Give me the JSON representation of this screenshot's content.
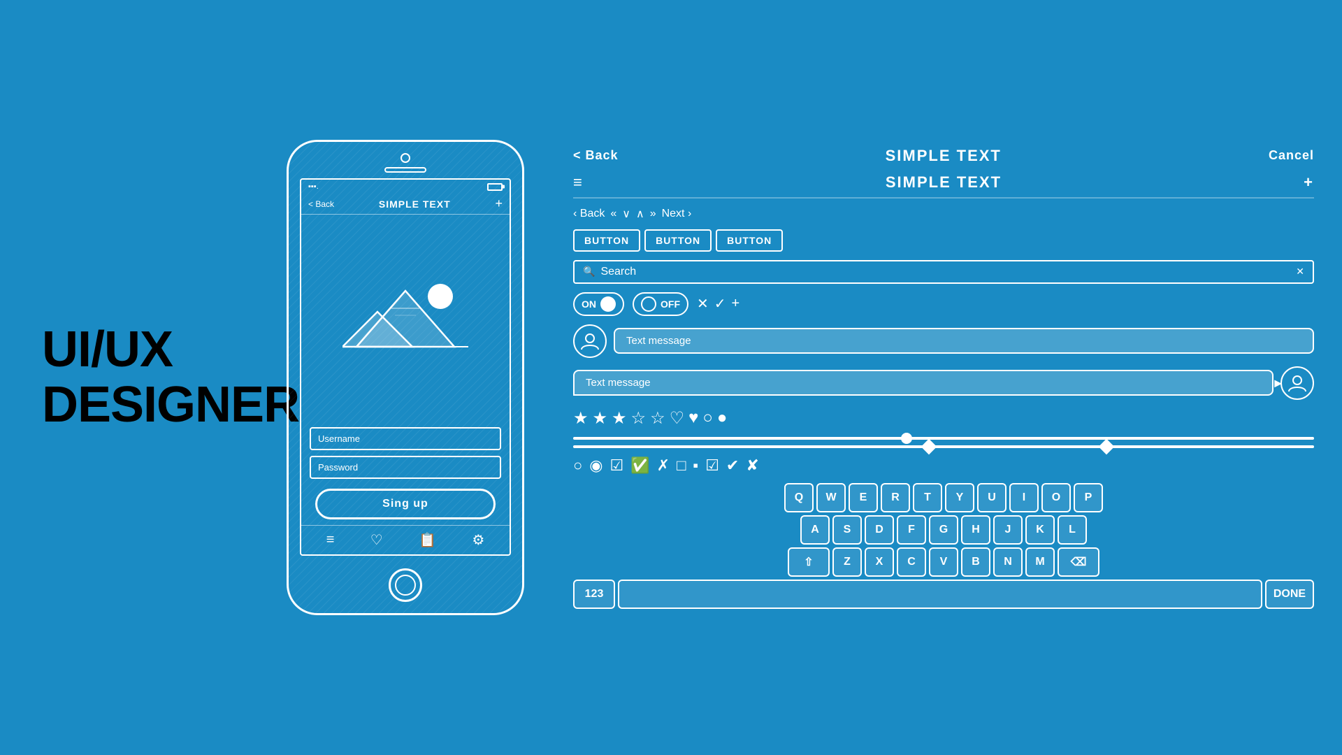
{
  "title": {
    "line1": "UI/UX",
    "line2": "DESIGNER"
  },
  "phone": {
    "status": {
      "signal": "▪▪▪",
      "battery_label": ""
    },
    "navbar": {
      "back": "< Back",
      "title": "SIMPLE TEXT",
      "plus": "+"
    },
    "username_placeholder": "Username",
    "password_placeholder": "Password",
    "signup_label": "Sing up",
    "bottom_icons": [
      "≡",
      "♡",
      "📋",
      "⚙"
    ]
  },
  "panel": {
    "nav": {
      "back": "< Back",
      "title": "SIMPLE TEXT",
      "cancel": "Cancel"
    },
    "nav2": {
      "hamburger": "≡",
      "title": "SIMPLE TEXT",
      "plus": "+"
    },
    "controls": [
      "< Back",
      "«",
      "∨",
      "∧",
      "»",
      "Next >"
    ],
    "buttons": [
      "BUTTON",
      "BUTTON",
      "BUTTON"
    ],
    "search_placeholder": "Search",
    "search_clear": "✕",
    "toggle_on": "ON",
    "toggle_off": "OFF",
    "toggle_extra": [
      "✕",
      "✓",
      "+"
    ],
    "message_placeholder_left": "Text message",
    "message_placeholder_right": "Text message",
    "stars": [
      "★",
      "★",
      "★",
      "☆",
      "☆"
    ],
    "hearts": [
      "♡",
      "♥"
    ],
    "bubbles": [
      "○",
      "●"
    ],
    "keyboard": {
      "row1": [
        "Q",
        "W",
        "E",
        "R",
        "T",
        "Y",
        "U",
        "I",
        "O",
        "P"
      ],
      "row2": [
        "A",
        "S",
        "D",
        "F",
        "G",
        "H",
        "J",
        "K",
        "L"
      ],
      "row3": [
        "⇧",
        "Z",
        "X",
        "C",
        "V",
        "B",
        "N",
        "M",
        "⌫"
      ],
      "row4_left": "123",
      "row4_space": "",
      "row4_done": "DONE"
    }
  }
}
